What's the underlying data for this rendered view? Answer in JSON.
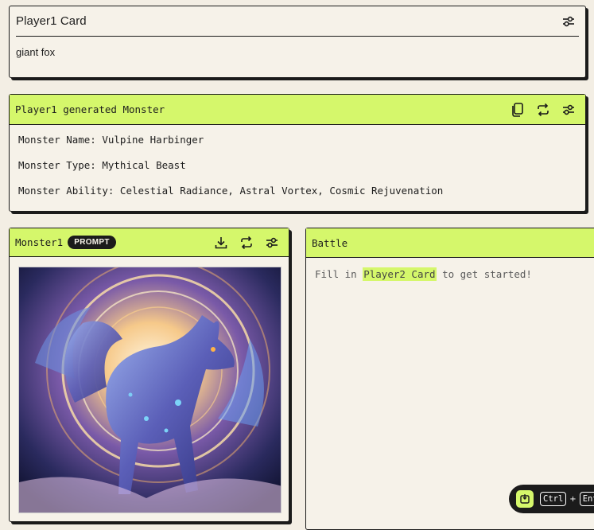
{
  "player_card": {
    "title": "Player1 Card",
    "value": "giant fox",
    "icons": [
      "settings-sliders-icon"
    ]
  },
  "generated": {
    "title": "Player1 generated Monster",
    "icons": [
      "copy-icon",
      "regenerate-icon",
      "settings-sliders-icon"
    ],
    "lines": [
      "Monster Name: Vulpine Harbinger",
      "Monster Type: Mythical Beast",
      "Monster Ability: Celestial Radiance, Astral Vortex, Cosmic Rejuvenation"
    ]
  },
  "monster": {
    "title": "Monster1",
    "badge": "PROMPT",
    "icons": [
      "download-icon",
      "regenerate-icon",
      "settings-sliders-icon"
    ],
    "image_alt": "glowing celestial wolf"
  },
  "battle": {
    "title": "Battle",
    "msg_prefix": "Fill in",
    "msg_highlight": "Player2 Card",
    "msg_suffix": "to get started!"
  },
  "shortcut": {
    "key1": "Ctrl",
    "plus": "+",
    "key2": "Enter"
  },
  "colors": {
    "accent": "#d5f76b",
    "background": "#f3eee4",
    "card": "#f6f2e9",
    "border": "#1b1b1b"
  }
}
